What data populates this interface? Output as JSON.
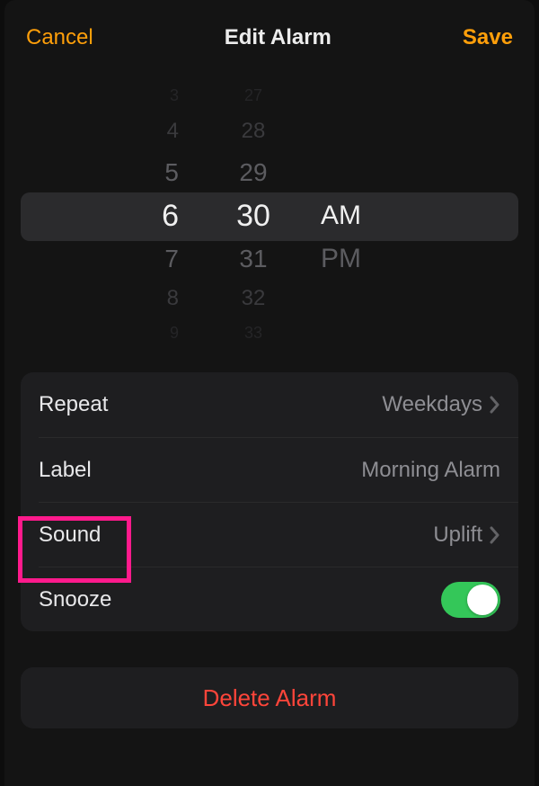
{
  "header": {
    "cancel": "Cancel",
    "title": "Edit Alarm",
    "save": "Save"
  },
  "picker": {
    "hours": [
      "3",
      "4",
      "5",
      "6",
      "7",
      "8",
      "9"
    ],
    "minutes": [
      "27",
      "28",
      "29",
      "30",
      "31",
      "32",
      "33"
    ],
    "ampm": [
      "AM",
      "PM"
    ],
    "selected_hour": "6",
    "selected_minute": "30",
    "selected_ampm": "AM"
  },
  "settings": {
    "repeat": {
      "label": "Repeat",
      "value": "Weekdays"
    },
    "label": {
      "label": "Label",
      "value": "Morning Alarm"
    },
    "sound": {
      "label": "Sound",
      "value": "Uplift"
    },
    "snooze": {
      "label": "Snooze",
      "on": true
    }
  },
  "delete_label": "Delete Alarm",
  "colors": {
    "accent": "#ff9f0a",
    "destructive": "#ff453a",
    "toggle_on": "#34c759",
    "highlight": "#ff1a8c"
  }
}
